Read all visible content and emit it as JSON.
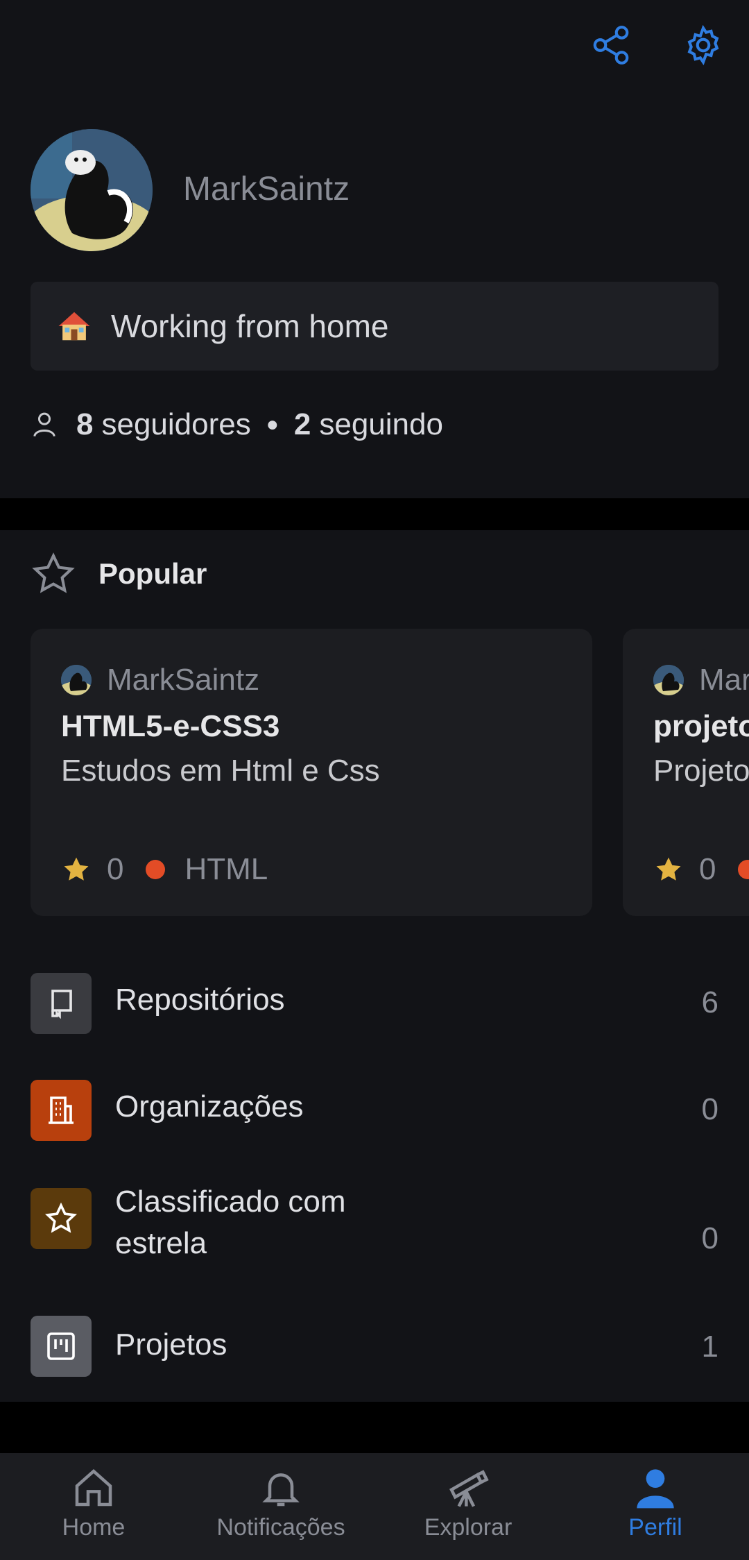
{
  "profile": {
    "username": "MarkSaintz",
    "status": "Working from home",
    "followers_count": "8",
    "followers_label": "seguidores",
    "following_count": "2",
    "following_label": "seguindo"
  },
  "popular": {
    "title": "Popular",
    "cards": [
      {
        "owner": "MarkSaintz",
        "repo": "HTML5-e-CSS3",
        "description": "Estudos em Html e Css",
        "stars": "0",
        "language": "HTML"
      },
      {
        "owner": "MarkSaintz",
        "repo": "projeto",
        "description": "Projeto",
        "stars": "0",
        "language": ""
      }
    ]
  },
  "menu": [
    {
      "label": "Repositórios",
      "count": "6",
      "icon": "repo-icon",
      "color": "#3a3b40"
    },
    {
      "label": "Organizações",
      "count": "0",
      "icon": "organization-icon",
      "color": "#b8400d"
    },
    {
      "label": "Classificado com estrela",
      "count": "0",
      "icon": "star-icon",
      "color": "#5b3a0c"
    },
    {
      "label": "Projetos",
      "count": "1",
      "icon": "project-icon",
      "color": "#5a5c63"
    }
  ],
  "nav": [
    {
      "label": "Home",
      "icon": "home-icon"
    },
    {
      "label": "Notificações",
      "icon": "bell-icon"
    },
    {
      "label": "Explorar",
      "icon": "telescope-icon"
    },
    {
      "label": "Perfil",
      "icon": "person-icon"
    }
  ],
  "colors": {
    "accent": "#2f7de1",
    "star": "#e3b341",
    "html_lang": "#e34c26"
  }
}
